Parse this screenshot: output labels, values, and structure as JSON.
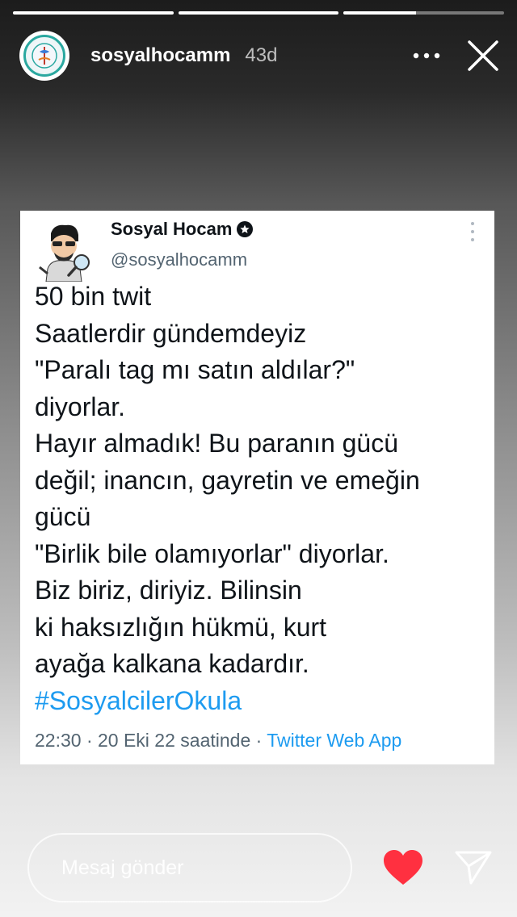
{
  "story": {
    "progress": [
      1.0,
      1.0,
      0.45,
      0.0
    ]
  },
  "header": {
    "username": "sosyalhocamm",
    "time": "43d",
    "avatar_icon": "school-logo-icon",
    "more_icon": "more-dots-icon",
    "close_icon": "close-icon"
  },
  "tweet": {
    "name": "Sosyal Hocam",
    "handle": "@sosyalhocamm",
    "lines": [
      "50 bin twit",
      "Saatlerdir gündemdeyiz",
      "\"Paralı tag mı satın aldılar?\"",
      "diyorlar.",
      "Hayır almadık! Bu paranın gücü",
      "değil; inancın, gayretin ve emeğin",
      "gücü",
      "\"Birlik bile olamıyorlar\" diyorlar.",
      "Biz biriz, diriyiz. Bilinsin",
      "ki haksızlığın hükmü, kurt",
      "ayağa kalkana kadardır."
    ],
    "hashtag": "#SosyalcilerOkula",
    "meta_prefix": "22:30 · 20 Eki 22 saatinde · ",
    "source": "Twitter Web App"
  },
  "footer": {
    "message_placeholder": "Mesaj gönder",
    "heart_color": "#ff3040",
    "heart_icon": "heart-icon",
    "send_icon": "send-icon"
  }
}
